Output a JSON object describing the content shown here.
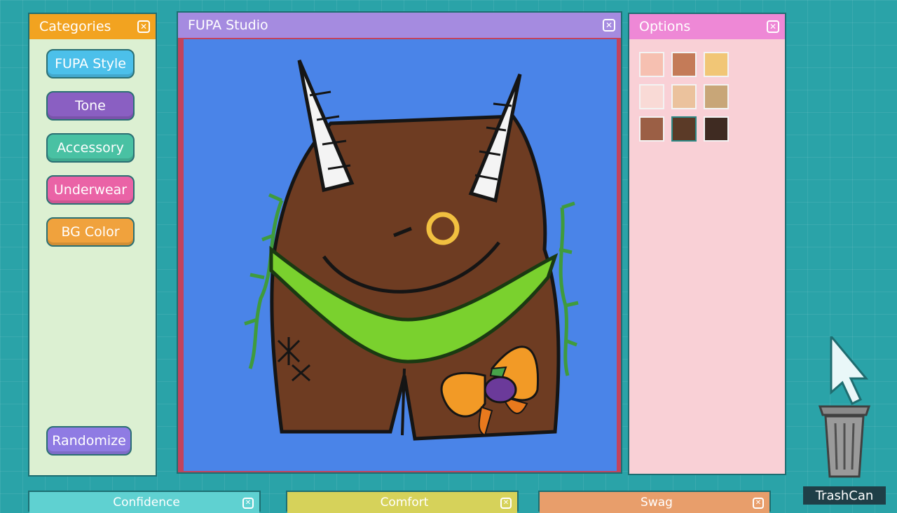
{
  "categories": {
    "title": "Categories",
    "items": [
      {
        "label": "FUPA Style",
        "color": "#4cc0ea"
      },
      {
        "label": "Tone",
        "color": "#8a5fc2"
      },
      {
        "label": "Accessory",
        "color": "#49c1a3"
      },
      {
        "label": "Underwear",
        "color": "#ea63a6"
      },
      {
        "label": "BG Color",
        "color": "#f0a23d"
      }
    ],
    "randomize_label": "Randomize",
    "randomize_color": "#8f7be3"
  },
  "studio": {
    "title": "FUPA Studio",
    "background_color": "#4a84e8"
  },
  "options": {
    "title": "Options",
    "swatches": [
      "#f6c0b1",
      "#c47b58",
      "#f1c676",
      "#f9dad6",
      "#ebc29d",
      "#c8a678",
      "#9b5f45",
      "#5b3a27",
      "#3f2b22"
    ],
    "selected_index": 7
  },
  "bottom_windows": [
    {
      "title": "Confidence",
      "color": "#5fd1d1"
    },
    {
      "title": "Comfort",
      "color": "#d6d25a"
    },
    {
      "title": "Swag",
      "color": "#e89e6b"
    }
  ],
  "trash": {
    "label": "TrashCan"
  }
}
